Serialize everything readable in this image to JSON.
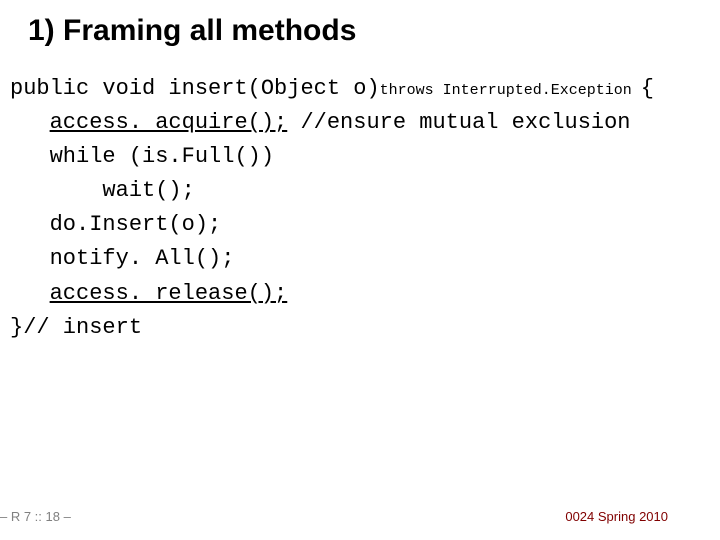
{
  "title": "1) Framing all methods",
  "code": {
    "sig_prefix": "public void insert(Object o)",
    "sig_throws": "throws Interrupted.Exception ",
    "sig_brace": "{",
    "line_acquire": "access. acquire();",
    "line_acquire_comment": " //ensure mutual exclusion",
    "line_while": "while (is.Full())",
    "line_wait": "wait();",
    "line_doinsert": "do.Insert(o);",
    "line_notify": "notify. All();",
    "line_release": "access. release();",
    "line_end": "}// insert"
  },
  "footer": {
    "page": "– R 7 :: 18 –",
    "course": "0024 Spring 2010"
  }
}
